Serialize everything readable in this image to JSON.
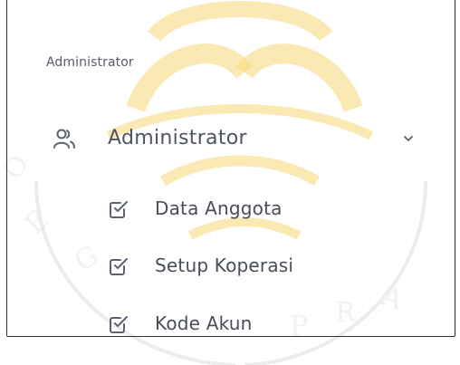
{
  "sidebar": {
    "section_heading": "Administrator",
    "menu": {
      "label": "Administrator",
      "icon": "users-icon",
      "expanded": true,
      "items": [
        {
          "label": "Data Anggota",
          "icon": "checkbox-icon"
        },
        {
          "label": "Setup Koperasi",
          "icon": "checkbox-icon"
        },
        {
          "label": "Kode Akun",
          "icon": "checkbox-icon"
        }
      ]
    }
  },
  "colors": {
    "text": "#4d5462",
    "icon": "#5b6270",
    "border": "#2e2e2e",
    "watermark": "#f5cd5a"
  }
}
